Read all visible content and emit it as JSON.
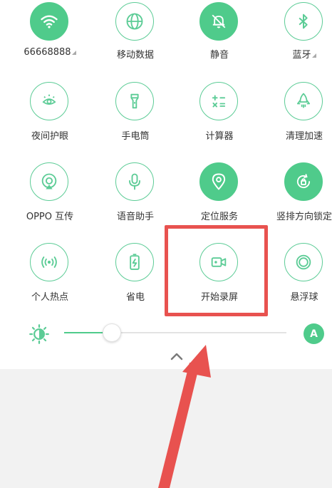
{
  "tiles": [
    {
      "label": "66668888",
      "icon": "wifi-icon",
      "active": true
    },
    {
      "label": "移动数据",
      "icon": "globe-icon",
      "active": false
    },
    {
      "label": "静音",
      "icon": "bell-mute-icon",
      "active": true
    },
    {
      "label": "蓝牙",
      "icon": "bluetooth-icon",
      "active": false
    },
    {
      "label": "夜间护眼",
      "icon": "eye-sun-icon",
      "active": false
    },
    {
      "label": "手电筒",
      "icon": "flashlight-icon",
      "active": false
    },
    {
      "label": "计算器",
      "icon": "calculator-icon",
      "active": false
    },
    {
      "label": "清理加速",
      "icon": "rocket-icon",
      "active": false
    },
    {
      "label": "OPPO 互传",
      "icon": "share-target-icon",
      "active": false
    },
    {
      "label": "语音助手",
      "icon": "microphone-icon",
      "active": false
    },
    {
      "label": "定位服务",
      "icon": "location-pin-icon",
      "active": true
    },
    {
      "label": "竖排方向锁定",
      "icon": "rotation-lock-icon",
      "active": true
    },
    {
      "label": "个人热点",
      "icon": "hotspot-icon",
      "active": false
    },
    {
      "label": "省电",
      "icon": "battery-saver-icon",
      "active": false
    },
    {
      "label": "开始录屏",
      "icon": "screen-record-icon",
      "active": false
    },
    {
      "label": "悬浮球",
      "icon": "floating-ball-icon",
      "active": false
    }
  ],
  "brightness": {
    "level": 0.21,
    "auto_label": "A"
  },
  "colors": {
    "accent": "#4fcb8b",
    "annotation": "#e8524f"
  }
}
